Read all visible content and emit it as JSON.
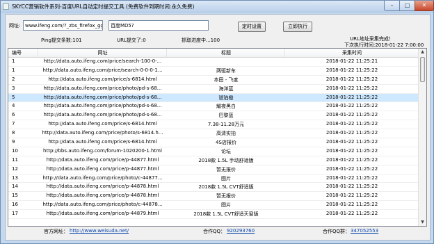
{
  "window": {
    "title": "SKYCC营销软件系列-百度URL自动定时提交工具 (免费软件到期时间:永久免费)",
    "min_label": "–",
    "max_label": "□",
    "close_label": "✕"
  },
  "form": {
    "url_label": "网址:",
    "url_value": "www.ifeng.com/?_zbs_firefox_gg",
    "md5_label": "百度MD5?",
    "md5_value": "",
    "schedule_button": "定时设置",
    "run_button": "立即执行"
  },
  "status": {
    "ping_count": "Ping提交条数:101",
    "url_submitted": "URL提交了:0",
    "fetch_progress": "抓取进度中...100",
    "collect_done": "URL地址采集完成！",
    "next_run": "下次执行时间:2018-01-22 7:00:00"
  },
  "table": {
    "headers": [
      "编号",
      "网址",
      "标题",
      "采集时间"
    ],
    "selected_row_index": 4,
    "rows": [
      {
        "id": "1",
        "url": "http://data.auto.ifeng.com/price/search-100-0-...",
        "title": "",
        "time": "2018-01-22 11:25:21"
      },
      {
        "id": "1",
        "url": "http://data.auto.ifeng.com/price/search-0-0-0-1...",
        "title": "两驱新车",
        "time": "2018-01-22 11:25:22"
      },
      {
        "id": "2",
        "url": "http://data.auto.ifeng.com/price/s-6814.html",
        "title": "本田 - 飞度",
        "time": "2018-01-22 11:25:22"
      },
      {
        "id": "3",
        "url": "http://data.auto.ifeng.com/price/photo/pd-s-68...",
        "title": "海洋蓝",
        "time": "2018-01-22 11:25:22"
      },
      {
        "id": "5",
        "url": "http://data.auto.ifeng.com/price/photo/pd-s-68...",
        "title": "琥珀橙",
        "time": "2018-01-22 11:25:22"
      },
      {
        "id": "4",
        "url": "http://data.auto.ifeng.com/price/photo/pd-s-68...",
        "title": "耀夜黑白",
        "time": "2018-01-22 11:25:22"
      },
      {
        "id": "6",
        "url": "http://data.auto.ifeng.com/price/photo/pd-s-68...",
        "title": "巴黎蓝",
        "time": "2018-01-22 11:25:22"
      },
      {
        "id": "7",
        "url": "http://data.auto.ifeng.com/price/s-6814.html",
        "title": "7.38-11.28万元",
        "time": "2018-01-22 11:25:22"
      },
      {
        "id": "8",
        "url": "http://data.auto.ifeng.com/price/photo/s-6814.h...",
        "title": "高清实拍",
        "time": "2018-01-22 11:25:22"
      },
      {
        "id": "9",
        "url": "http://data.auto.ifeng.com/price/s-6814.html",
        "title": "4S店报价",
        "time": "2018-01-22 11:25:22"
      },
      {
        "id": "10",
        "url": "http://bbs.auto.ifeng.com/forum-1020200-1.html",
        "title": "论坛",
        "time": "2018-01-22 11:25:22"
      },
      {
        "id": "11",
        "url": "http://data.auto.ifeng.com/price/p-44877.html",
        "title": "2018款 1.5L 手动舒适版",
        "time": "2018-01-22 11:25:22"
      },
      {
        "id": "12",
        "url": "http://data.auto.ifeng.com/price/p-44877.html",
        "title": "暂无报价",
        "time": "2018-01-22 11:25:22"
      },
      {
        "id": "13",
        "url": "http://data.auto.ifeng.com/price/photo/c-44877...",
        "title": "图片",
        "time": "2018-01-22 11:25:22"
      },
      {
        "id": "14",
        "url": "http://data.auto.ifeng.com/price/p-44878.html",
        "title": "2018款 1.5L CVT舒适版",
        "time": "2018-01-22 11:25:22"
      },
      {
        "id": "15",
        "url": "http://data.auto.ifeng.com/price/p-44878.html",
        "title": "暂无报价",
        "time": "2018-01-22 11:25:22"
      },
      {
        "id": "16",
        "url": "http://data.auto.ifeng.com/price/photo/c-44878...",
        "title": "图片",
        "time": "2018-01-22 11:25:22"
      },
      {
        "id": "17",
        "url": "http://data.auto.ifeng.com/price/p-44879.html",
        "title": "2018款 1.5L CVT舒适天窗版",
        "time": "2018-01-22 11:25:22"
      }
    ]
  },
  "footer": {
    "site_label": "官方网址：",
    "site_url": "http://www.weisuda.net/",
    "qq_label": "合作QQ：",
    "qq_value": "920293760",
    "qq_group_label": "合作QQ群：",
    "qq_group_value": "347052553"
  },
  "icons": {
    "scroll_up": "scroll-up-arrow-icon",
    "scroll_down": "scroll-down-arrow-icon"
  }
}
